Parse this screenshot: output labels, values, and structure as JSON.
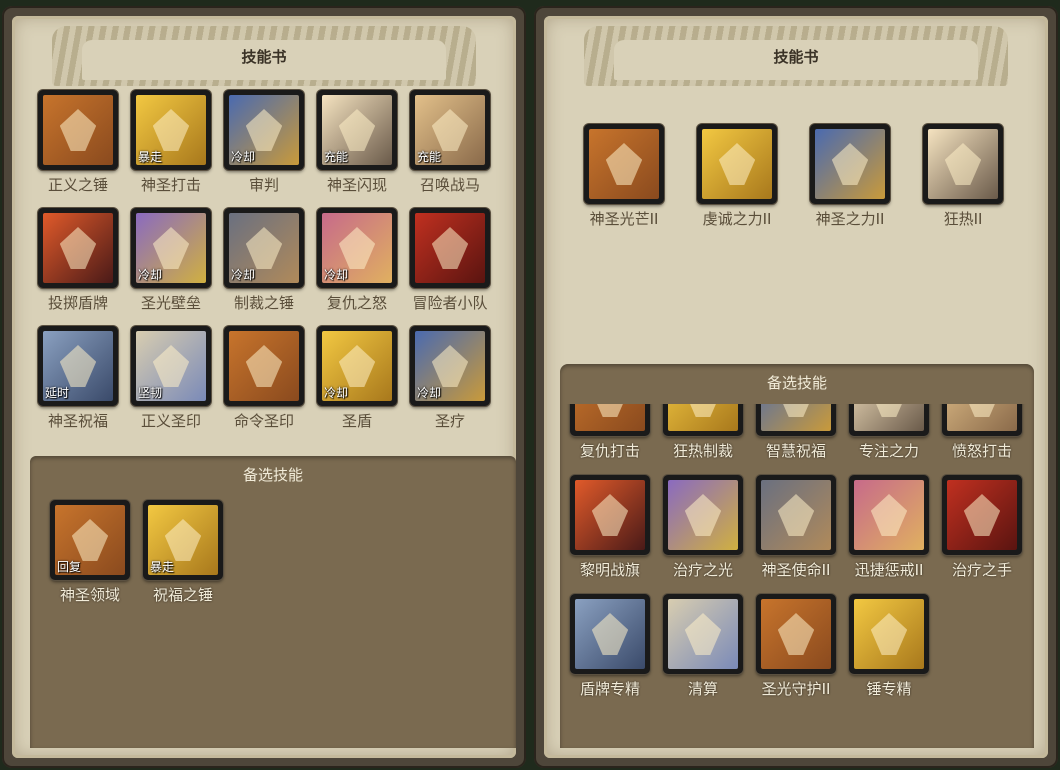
{
  "left_book": {
    "title": "技能书",
    "skills": [
      {
        "name": "正义之锤",
        "badge": "",
        "icon": "hammer-of-justice-icon"
      },
      {
        "name": "神圣打击",
        "badge": "暴走",
        "icon": "crusader-strike-icon"
      },
      {
        "name": "审判",
        "badge": "冷却",
        "icon": "judgment-icon"
      },
      {
        "name": "神圣闪现",
        "badge": "充能",
        "icon": "holy-flash-icon"
      },
      {
        "name": "召唤战马",
        "badge": "充能",
        "icon": "summon-warhorse-icon"
      },
      {
        "name": "投掷盾牌",
        "badge": "",
        "icon": "shield-throw-icon"
      },
      {
        "name": "圣光壁垒",
        "badge": "冷却",
        "icon": "holy-bulwark-icon"
      },
      {
        "name": "制裁之锤",
        "badge": "冷却",
        "icon": "hammer-of-sanction-icon"
      },
      {
        "name": "复仇之怒",
        "badge": "冷却",
        "icon": "avenging-wrath-icon"
      },
      {
        "name": "冒险者小队",
        "badge": "",
        "icon": "adventurer-party-icon"
      },
      {
        "name": "神圣祝福",
        "badge": "延时",
        "icon": "divine-blessing-icon"
      },
      {
        "name": "正义圣印",
        "badge": "坚韧",
        "icon": "seal-of-righteousness-icon"
      },
      {
        "name": "命令圣印",
        "badge": "",
        "icon": "seal-of-command-icon"
      },
      {
        "name": "圣盾",
        "badge": "冷却",
        "icon": "divine-shield-icon"
      },
      {
        "name": "圣疗",
        "badge": "冷却",
        "icon": "lay-on-hands-icon"
      }
    ],
    "reserve_title": "备选技能",
    "reserve": [
      {
        "name": "神圣领域",
        "badge": "回复",
        "icon": "holy-domain-icon"
      },
      {
        "name": "祝福之锤",
        "badge": "暴走",
        "icon": "blessed-hammer-icon"
      }
    ]
  },
  "right_book": {
    "title": "技能书",
    "skills": [
      {
        "name": "神圣光芒II",
        "badge": "",
        "icon": "holy-radiance-icon"
      },
      {
        "name": "虔诚之力II",
        "badge": "",
        "icon": "devotion-aura-icon"
      },
      {
        "name": "神圣之力II",
        "badge": "",
        "icon": "holy-might-icon"
      },
      {
        "name": "狂热II",
        "badge": "",
        "icon": "zeal-icon"
      }
    ],
    "reserve_title": "备选技能",
    "reserve": [
      {
        "name": "复仇打击",
        "badge": "",
        "icon": "vengeful-strike-icon"
      },
      {
        "name": "狂热制裁",
        "badge": "",
        "icon": "zealous-sanction-icon"
      },
      {
        "name": "智慧祝福",
        "badge": "",
        "icon": "blessing-of-wisdom-icon"
      },
      {
        "name": "专注之力",
        "badge": "",
        "icon": "concentration-icon"
      },
      {
        "name": "愤怒打击",
        "badge": "",
        "icon": "wrathful-strike-icon"
      },
      {
        "name": "黎明战旗",
        "badge": "",
        "icon": "dawn-banner-icon"
      },
      {
        "name": "治疗之光",
        "badge": "",
        "icon": "healing-light-icon"
      },
      {
        "name": "神圣使命II",
        "badge": "",
        "icon": "holy-mission-icon"
      },
      {
        "name": "迅捷惩戒II",
        "badge": "",
        "icon": "swift-retribution-icon"
      },
      {
        "name": "治疗之手",
        "badge": "",
        "icon": "healing-hand-icon"
      },
      {
        "name": "盾牌专精",
        "badge": "",
        "icon": "shield-mastery-icon"
      },
      {
        "name": "清算",
        "badge": "",
        "icon": "reckoning-icon"
      },
      {
        "name": "圣光守护II",
        "badge": "",
        "icon": "holy-guardian-icon"
      },
      {
        "name": "锤专精",
        "badge": "",
        "icon": "hammer-mastery-icon"
      }
    ]
  }
}
